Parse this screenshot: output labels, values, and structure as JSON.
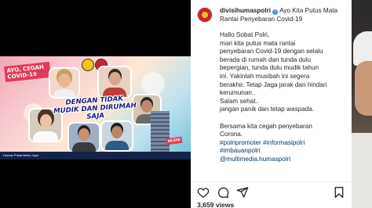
{
  "post": {
    "username": "divisihumaspolri",
    "caption_head_text": "Ayo Kita Putus Mata Rantai Penyebaran Covid-19",
    "caption_lines": [
      "Hallo Sobat Polri,",
      "mari kita putus mata rantai",
      "penyebaran Covid-19 dengan selalu",
      "berada di rumah dan tunda dulu",
      "bepergian, tunda dulu mudik tahun",
      "ini. Yakinlah musibah ini segera",
      "berakhir. Tetap Jaga jarak dan hindari",
      "kerumunan..",
      "Salam sehat..",
      "jangan panik dan tetap waspada.",
      "",
      "Bersama kita cegah penyebaran",
      "Corona."
    ],
    "hashtags": [
      "#polripromoter #informasipolri",
      "#imbauanpolri",
      "@multimedia.humaspolri"
    ],
    "views": "3,659 views"
  },
  "poster": {
    "title": "AYO, CEGAH COVID-19",
    "slogan": "DENGAN TIDAK MUDIK DAN DIRUMAH SAJA",
    "footer": "Humas Polda Metro Jaya",
    "tag": "MUDIK"
  },
  "colors": {
    "accent_pink": "#e23a57",
    "navy": "#1c1c7a",
    "link": "#00376b",
    "verified": "#3897f0"
  },
  "icons": [
    "heart-icon",
    "comment-icon",
    "share-icon",
    "bookmark-icon",
    "verified-icon"
  ]
}
